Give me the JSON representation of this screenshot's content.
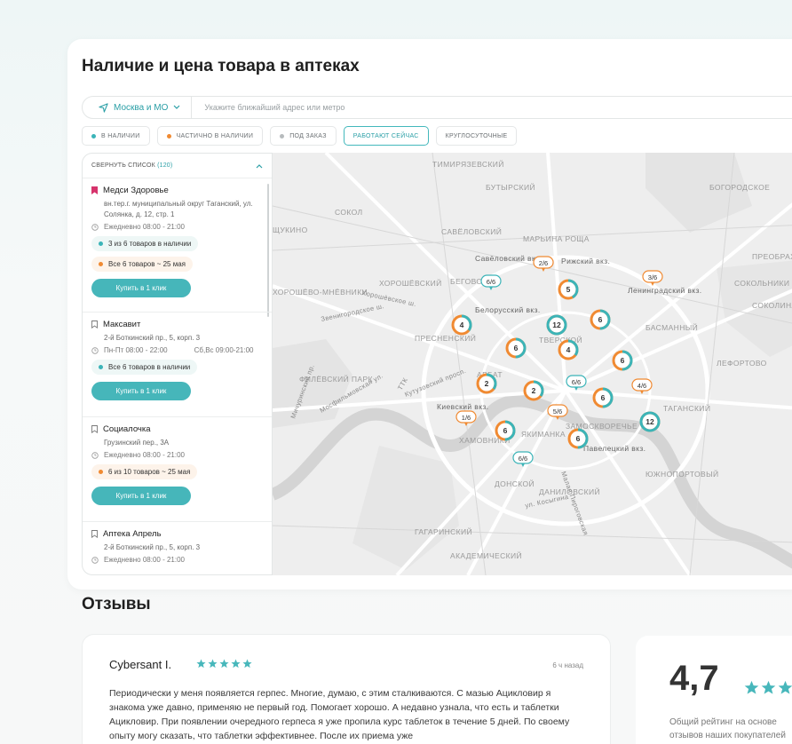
{
  "card": {
    "title": "Наличие и цена товара в аптеках"
  },
  "search": {
    "region": "Москва и МО",
    "placeholder": "Укажите ближайший адрес или метро"
  },
  "filters": [
    {
      "label": "В НАЛИЧИИ",
      "dot": "#3bb4b8"
    },
    {
      "label": "ЧАСТИЧНО В НАЛИЧИИ",
      "dot": "#f08a32"
    },
    {
      "label": "ПОД ЗАКАЗ",
      "dot": "#b7bbbd"
    },
    {
      "label": "РАБОТАЮТ СЕЙЧАС",
      "dot": ""
    },
    {
      "label": "КРУГЛОСУТОЧНЫЕ",
      "dot": ""
    }
  ],
  "list": {
    "collapse_label": "СВЕРНУТЬ СПИСОК",
    "count": "(120)",
    "pharmacies": [
      {
        "name": "Медси Здоровье",
        "address": "вн.тер.г. муниципальный округ Таганский, ул. Солянка, д. 12, стр. 1",
        "hours": "Ежедневно 08:00 - 21:00",
        "hours2": "",
        "availability": [
          {
            "text": "3 из 6 товаров в наличии",
            "color": "green"
          },
          {
            "text": "Все 6 товаров ~ 25 мая",
            "color": "orange"
          }
        ],
        "button": "Купить в 1 клик"
      },
      {
        "name": "Максавит",
        "address": "2-й Боткинский пр., 5, корп. 3",
        "hours": "Пн-Пт 08:00 - 22:00",
        "hours2": "Сб,Вс 09:00-21:00",
        "availability": [
          {
            "text": "Все 6 товаров в наличии",
            "color": "green"
          }
        ],
        "button": "Купить в 1 клик"
      },
      {
        "name": "Социалочка",
        "address": "Грузинский пер., 3А",
        "hours": "Ежедневно 08:00 - 21:00",
        "hours2": "",
        "availability": [
          {
            "text": "6 из 10 товаров ~ 25 мая",
            "color": "orange"
          }
        ],
        "button": "Купить в 1 клик"
      },
      {
        "name": "Аптека Апрель",
        "address": "2-й Боткинский пр., 5, корп. 3",
        "hours": "Ежедневно 08:00 - 21:00",
        "hours2": "",
        "availability": [],
        "button": ""
      }
    ]
  },
  "map": {
    "districts": [
      "ТИМИРЯЗЕВСКИЙ",
      "БУТЫРСКИЙ",
      "БОГОРОДСКОЕ",
      "СОКОЛ",
      "САВЁЛОВСКИЙ",
      "МАРЬИНА РОЩА",
      "ХОРОШЁВСКИЙ",
      "БЕГОВОЙ",
      "СОКОЛЬНИКИ",
      "ПРЕОБРАЖЕНСКОЕ",
      "ХОРОШЁВО-МНЁВНИКИ",
      "ПРЕСНЕНСКИЙ",
      "БАСМАННЫЙ",
      "СОКОЛИНАЯ ГОРА",
      "ФИЛЁВСКИЙ ПАРК",
      "ЛЕФОРТОВО",
      "ТАГАНСКИЙ",
      "ХАМОВНИКИ",
      "ЗАМОСКВОРЕЧЬЕ",
      "ЯКИМАНКА",
      "ДОНСКОЙ",
      "ДАНИЛОВСКИЙ",
      "ЮЖНОПОРТОВЫЙ",
      "ГАГАРИНСКИЙ",
      "АКАДЕМИЧЕСКИЙ",
      "ЩУКИНО",
      "ТВЕРСКОЙ",
      "АРБАТ"
    ],
    "stations": [
      "Савёловский вкз.",
      "Рижский вкз.",
      "Белорусский вкз.",
      "Ленинградский вкз.",
      "Киевский вкз.",
      "Павелецкий вкз."
    ],
    "roads": [
      "ТТК",
      "Хорошёвское ш.",
      "Звенигородское ш.",
      "Кутузовский просп.",
      "ул. Косыгина",
      "Мичуринский пр.",
      "Мосфильмовская ул.",
      "Малая Пироговская"
    ],
    "markers": [
      {
        "label": "2/6",
        "kind": "tag"
      },
      {
        "label": "3/6",
        "kind": "tag"
      },
      {
        "label": "6/6",
        "kind": "tag"
      },
      {
        "label": "5",
        "kind": "circle"
      },
      {
        "label": "4",
        "kind": "circle"
      },
      {
        "label": "12",
        "kind": "circle"
      },
      {
        "label": "6",
        "kind": "circle"
      },
      {
        "label": "6",
        "kind": "circle"
      },
      {
        "label": "4",
        "kind": "circle"
      },
      {
        "label": "6",
        "kind": "circle"
      },
      {
        "label": "6/6",
        "kind": "tag"
      },
      {
        "label": "4/6",
        "kind": "tag"
      },
      {
        "label": "2",
        "kind": "circle"
      },
      {
        "label": "2",
        "kind": "circle"
      },
      {
        "label": "6",
        "kind": "circle"
      },
      {
        "label": "1/6",
        "kind": "tag"
      },
      {
        "label": "5/6",
        "kind": "tag"
      },
      {
        "label": "12",
        "kind": "circle"
      },
      {
        "label": "6",
        "kind": "circle"
      },
      {
        "label": "6",
        "kind": "circle"
      },
      {
        "label": "6/6",
        "kind": "tag"
      }
    ]
  },
  "reviews": {
    "title": "Отзывы",
    "items": [
      {
        "author": "Cybersant I.",
        "time": "6 ч назад",
        "stars": 5,
        "text": "Периодически у меня появляется герпес. Многие, думаю, с этим сталкиваются. С мазью Ацикловир я знакома уже давно, применяю не первый год. Помогает хорошо. А недавно узнала, что есть и таблетки Ацикловир. При появлении очередного герпеса я уже пропила курс таблеток в течение 5 дней. По своему опыту могу сказать, что таблетки эффективнее. После их приема уже"
      }
    ]
  },
  "rating": {
    "value": "4,7",
    "caption": "Общий рейтинг на основе отзывов наших покупателей"
  },
  "colors": {
    "accent": "#46b6ba",
    "orange": "#f08a32",
    "green_dot": "#3bb4b8"
  }
}
